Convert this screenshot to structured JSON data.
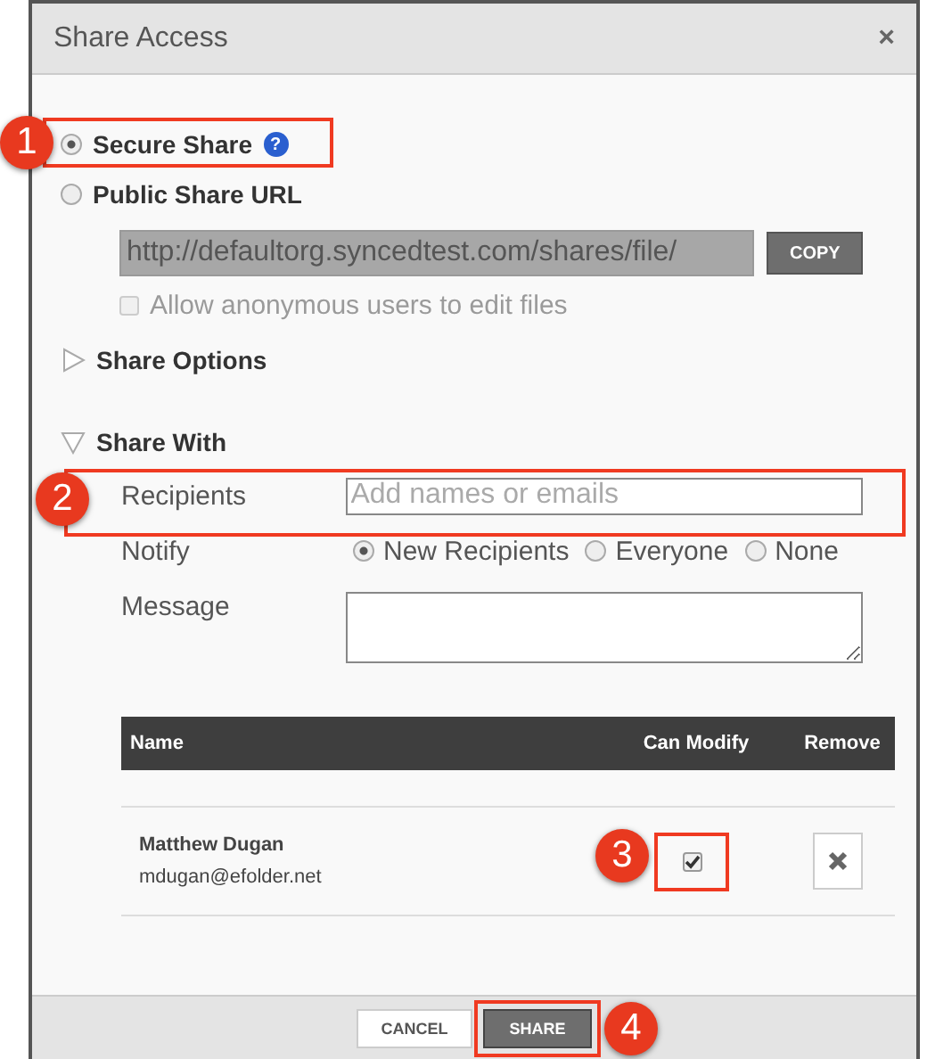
{
  "dialog": {
    "title": "Share Access",
    "close": "×"
  },
  "share_type": [
    {
      "label": "Secure Share",
      "selected": true,
      "help": "?",
      "callout": "1"
    },
    {
      "label": "Public Share URL",
      "selected": false
    }
  ],
  "url_field": {
    "value": "http://defaultorg.syncedtest.com/shares/file/",
    "copy": "COPY",
    "disabled": true
  },
  "anonymous_edit": {
    "label": "Allow anonymous users to edit files",
    "checked": false,
    "disabled": true
  },
  "sections": [
    {
      "label": "Share Options",
      "expanded": false
    },
    {
      "label": "Share With",
      "expanded": true
    }
  ],
  "recipients": {
    "label": "Recipients",
    "placeholder": "Add names or emails",
    "callout": "2"
  },
  "notify": {
    "label": "Notify",
    "options": [
      {
        "label": "New Recipients",
        "selected": true
      },
      {
        "label": "Everyone",
        "selected": false
      },
      {
        "label": "None",
        "selected": false
      }
    ]
  },
  "message": {
    "label": "Message"
  },
  "table": {
    "columns": [
      "Name",
      "Can Modify",
      "Remove"
    ],
    "rows": [
      {
        "name": "Matthew Dugan",
        "email": "mdugan@efolder.net",
        "can_modify": true,
        "callout": "3"
      }
    ]
  },
  "buttons": [
    {
      "label": "CANCEL",
      "kind": "secondary"
    },
    {
      "label": "SHARE",
      "kind": "primary",
      "callout": "4"
    }
  ]
}
